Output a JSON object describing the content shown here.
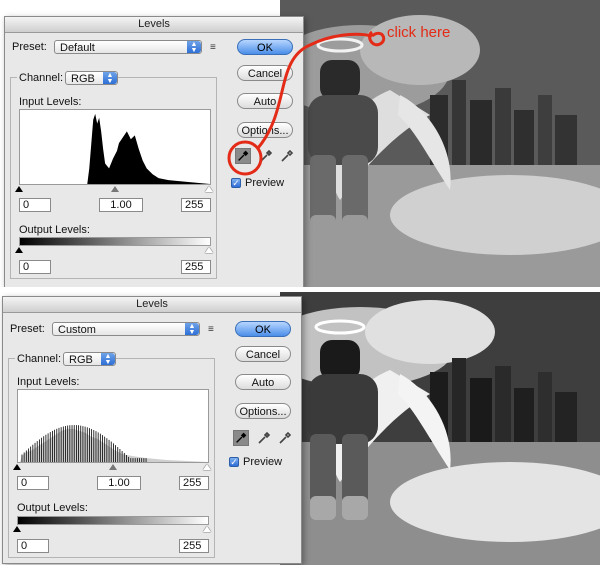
{
  "annotation": {
    "text": "click here",
    "color": "#e32b17"
  },
  "dialogs": [
    {
      "title": "Levels",
      "preset_label": "Preset:",
      "preset_value": "Default",
      "channel_label": "Channel:",
      "channel_value": "RGB",
      "input_levels_label": "Input Levels:",
      "output_levels_label": "Output Levels:",
      "input_black": "0",
      "input_gamma": "1.00",
      "input_white": "255",
      "output_black": "0",
      "output_white": "255",
      "buttons": {
        "ok": "OK",
        "cancel": "Cancel",
        "auto": "Auto",
        "options": "Options..."
      },
      "preview_label": "Preview",
      "preview_checked": true,
      "selected_eyedropper": "black"
    },
    {
      "title": "Levels",
      "preset_label": "Preset:",
      "preset_value": "Custom",
      "channel_label": "Channel:",
      "channel_value": "RGB",
      "input_levels_label": "Input Levels:",
      "output_levels_label": "Output Levels:",
      "input_black": "0",
      "input_gamma": "1.00",
      "input_white": "255",
      "output_black": "0",
      "output_white": "255",
      "buttons": {
        "ok": "OK",
        "cancel": "Cancel",
        "auto": "Auto",
        "options": "Options..."
      },
      "preview_label": "Preview",
      "preview_checked": true,
      "selected_eyedropper": "black"
    }
  ]
}
